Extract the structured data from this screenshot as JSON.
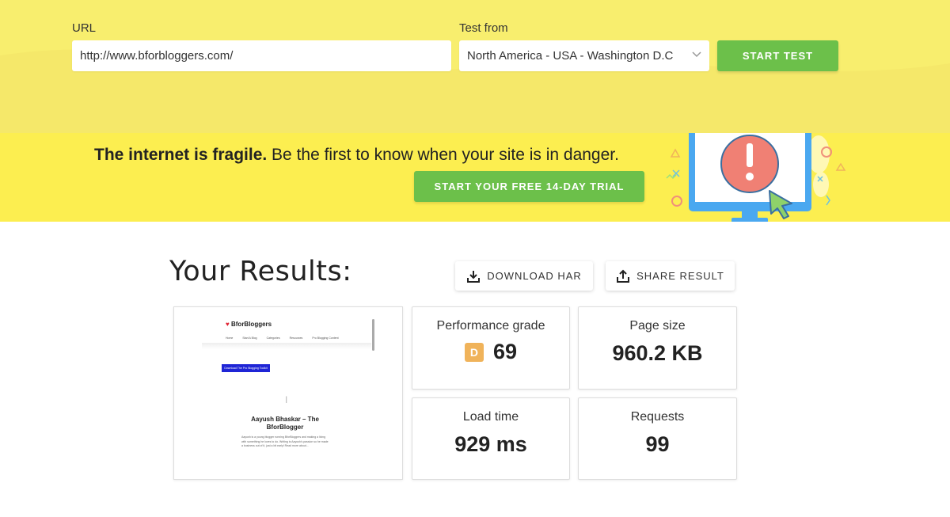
{
  "form": {
    "url_label": "URL",
    "url_value": "http://www.bforbloggers.com/",
    "test_from_label": "Test from",
    "test_from_value": "North America - USA - Washington D.C",
    "start_button": "START TEST"
  },
  "banner": {
    "headline_bold": "The internet is fragile.",
    "headline_rest": " Be the first to know when your site is in danger.",
    "trial_button": "START YOUR FREE 14-DAY TRIAL"
  },
  "results": {
    "title": "Your Results:",
    "download_button": "DOWNLOAD HAR",
    "share_button": "SHARE RESULT",
    "performance": {
      "label": "Performance grade",
      "grade": "D",
      "value": "69"
    },
    "page_size": {
      "label": "Page size",
      "value": "960.2 KB"
    },
    "load_time": {
      "label": "Load time",
      "value": "929 ms"
    },
    "requests": {
      "label": "Requests",
      "value": "99"
    }
  },
  "preview": {
    "logo": "BforBloggers",
    "nav": [
      "Home",
      "Start A Blog",
      "Categories",
      "Resources",
      "Pro Blogging Content"
    ],
    "button": "Download The Pro Blogging Toolkit",
    "name": "Aayush Bhaskar – The BforBlogger",
    "paragraph": "Aayush is a young blogger running BforBloggers and making a living with something he loves to do. Writing is Aayush's passion so he made a business out of it, just a bit early! Read more about..."
  },
  "colors": {
    "top_bg": "#f8ee6e",
    "banner_bg": "#fcee50",
    "green": "#6cc04a",
    "grade_d": "#f0b35a"
  }
}
